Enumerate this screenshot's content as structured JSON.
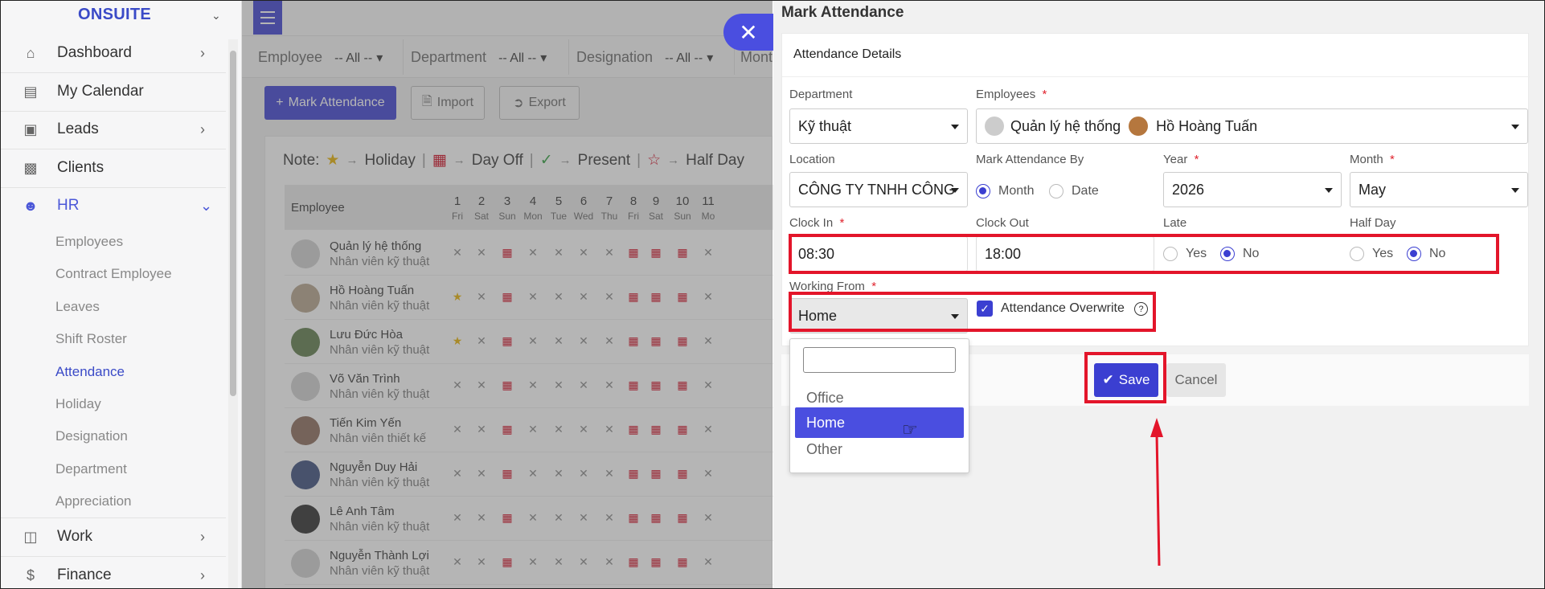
{
  "sidebar": {
    "brand": "ONSUITE",
    "items": [
      {
        "label": "Dashboard",
        "icon": "home-icon"
      },
      {
        "label": "My Calendar",
        "icon": "calendar-icon"
      },
      {
        "label": "Leads",
        "icon": "contact-card-icon"
      },
      {
        "label": "Clients",
        "icon": "building-icon"
      },
      {
        "label": "HR",
        "icon": "users-icon"
      }
    ],
    "hr_sub": [
      "Employees",
      "Contract Employee",
      "Leaves",
      "Shift Roster",
      "Attendance",
      "Holiday",
      "Designation",
      "Department",
      "Appreciation"
    ],
    "bottom_items": [
      {
        "label": "Work",
        "icon": "briefcase-icon"
      },
      {
        "label": "Finance",
        "icon": "dollar-icon"
      }
    ]
  },
  "filters": {
    "employee_label": "Employee",
    "employee_value": "-- All --",
    "department_label": "Department",
    "department_value": "-- All --",
    "designation_label": "Designation",
    "designation_value": "-- All --",
    "month_label": "Mont"
  },
  "actions": {
    "mark": "Mark Attendance",
    "import": "Import",
    "export": "Export"
  },
  "note": {
    "prefix": "Note:",
    "holiday": "Holiday",
    "dayoff": "Day Off",
    "present": "Present",
    "halfday": "Half Day"
  },
  "table": {
    "employee_header": "Employee",
    "days": [
      "1",
      "2",
      "3",
      "4",
      "5",
      "6",
      "7",
      "8",
      "9",
      "10",
      "11"
    ],
    "weekdays": [
      "Fri",
      "Sat",
      "Sun",
      "Mon",
      "Tue",
      "Wed",
      "Thu",
      "Fri",
      "Sat",
      "Sun",
      "Mo"
    ],
    "rows": [
      {
        "name": "Quản lý hệ thống",
        "role": "Nhân viên kỹ thuật"
      },
      {
        "name": "Hồ Hoàng Tuấn",
        "role": "Nhân viên kỹ thuật"
      },
      {
        "name": "Lưu Đức Hòa",
        "role": "Nhân viên kỹ thuật"
      },
      {
        "name": "Võ Văn Trình",
        "role": "Nhân viên kỹ thuật"
      },
      {
        "name": "Tiến Kim Yến",
        "role": "Nhân viên thiết kế"
      },
      {
        "name": "Nguyễn Duy Hải",
        "role": "Nhân viên kỹ thuật"
      },
      {
        "name": "Lê Anh Tâm",
        "role": "Nhân viên kỹ thuật"
      },
      {
        "name": "Nguyễn Thành Lợi",
        "role": "Nhân viên kỹ thuật"
      }
    ]
  },
  "modal": {
    "title": "Mark Attendance",
    "section": "Attendance Details",
    "department_label": "Department",
    "department_value": "Kỹ thuật",
    "employees_label": "Employees",
    "employee_chip1": "Quản lý hệ thống",
    "employee_chip2": "Hồ Hoàng Tuấn",
    "location_label": "Location",
    "location_value": "CÔNG TY TNHH CÔNG",
    "markby_label": "Mark Attendance By",
    "markby_month": "Month",
    "markby_date": "Date",
    "year_label": "Year",
    "year_value": "2026",
    "month_label": "Month",
    "month_value": "May",
    "clockin_label": "Clock In",
    "clockin_value": "08:30",
    "clockout_label": "Clock Out",
    "clockout_value": "18:00",
    "late_label": "Late",
    "halfday_label": "Half Day",
    "yes": "Yes",
    "no": "No",
    "workingfrom_label": "Working From",
    "workingfrom_value": "Home",
    "overwrite_label": "Attendance Overwrite",
    "save": "Save",
    "cancel": "Cancel",
    "required_mark": "*"
  },
  "dropdown": {
    "options": [
      "Office",
      "Home",
      "Other"
    ],
    "selected": "Home"
  },
  "colors": {
    "accent": "#3b3fd1",
    "highlight": "#e3152a",
    "holiday_star": "#e8b100",
    "dayoff": "#d0021b"
  }
}
